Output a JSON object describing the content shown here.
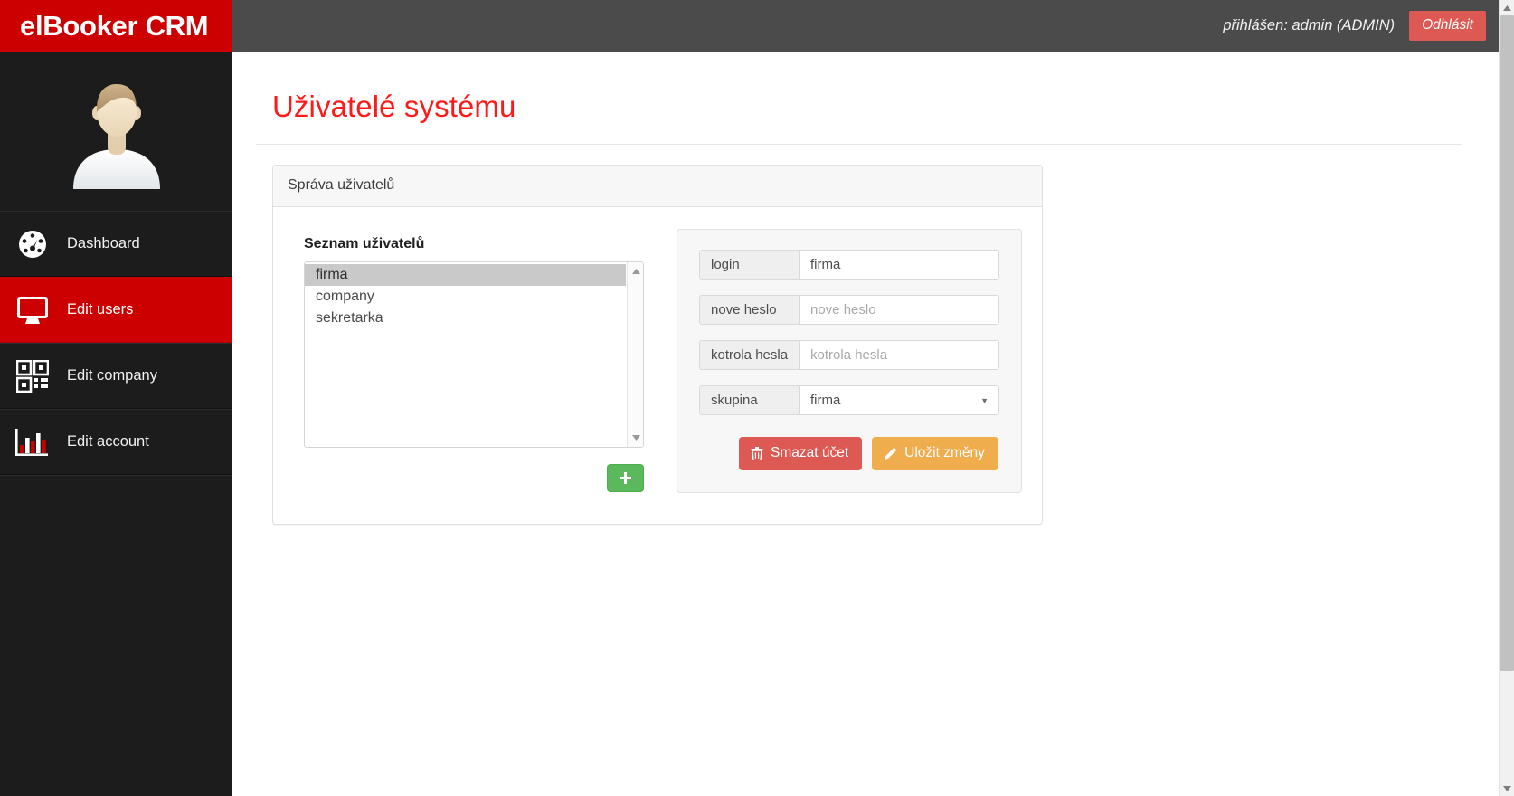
{
  "brand": {
    "title": "elBooker CRM"
  },
  "header": {
    "logged_in_text": "přihlášen: admin (ADMIN)",
    "logout_label": "Odhlásit"
  },
  "sidebar": {
    "avatar_alt": "user-avatar",
    "items": [
      {
        "label": "Dashboard",
        "icon": "dashboard-gauge-icon",
        "active": false
      },
      {
        "label": "Edit users",
        "icon": "monitor-icon",
        "active": true
      },
      {
        "label": "Edit company",
        "icon": "qr-code-icon",
        "active": false
      },
      {
        "label": "Edit account",
        "icon": "bar-chart-icon",
        "active": false
      }
    ]
  },
  "page": {
    "title": "Uživatelé systému"
  },
  "panel": {
    "heading": "Správa uživatelů",
    "user_list": {
      "label": "Seznam uživatelů",
      "options": [
        "firma",
        "company",
        "sekretarka"
      ],
      "selected": "firma"
    },
    "add_button_label": "+",
    "form": {
      "fields": [
        {
          "label": "login",
          "value": "firma",
          "placeholder": "",
          "type": "text"
        },
        {
          "label": "nove heslo",
          "value": "",
          "placeholder": "nove heslo",
          "type": "password"
        },
        {
          "label": "kotrola hesla",
          "value": "",
          "placeholder": "kotrola hesla",
          "type": "password"
        },
        {
          "label": "skupina",
          "value": "firma",
          "placeholder": "",
          "type": "select"
        }
      ],
      "delete_label": "Smazat účet",
      "save_label": "Uložit změny"
    }
  },
  "colors": {
    "brand_red": "#cc0000",
    "title_red": "#ff1a1a",
    "danger": "#dd5a54",
    "warning": "#f0ad4e",
    "success": "#5cb85c",
    "sidebar_bg": "#1c1c1c",
    "topbar_bg": "#4b4b4b"
  }
}
